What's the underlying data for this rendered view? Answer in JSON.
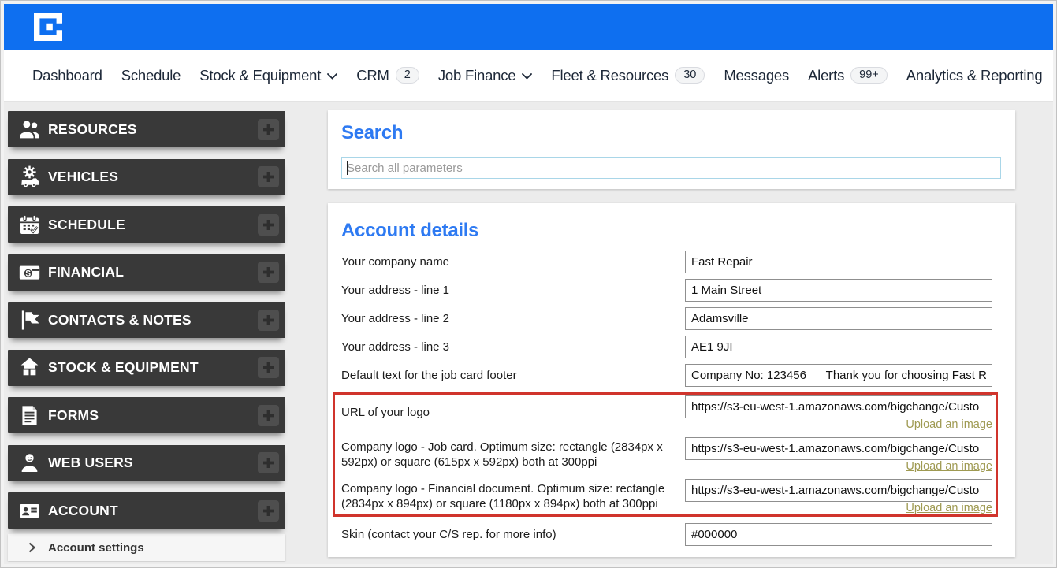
{
  "nav": {
    "items": [
      {
        "label": "Dashboard"
      },
      {
        "label": "Schedule"
      },
      {
        "label": "Stock & Equipment",
        "has_dropdown": true
      },
      {
        "label": "CRM",
        "badge": "2"
      },
      {
        "label": "Job Finance",
        "has_dropdown": true
      },
      {
        "label": "Fleet & Resources",
        "badge": "30"
      },
      {
        "label": "Messages"
      },
      {
        "label": "Alerts",
        "badge": "99+"
      },
      {
        "label": "Analytics & Reporting"
      }
    ]
  },
  "sidebar": {
    "items": [
      {
        "label": "RESOURCES",
        "icon": "people-icon"
      },
      {
        "label": "VEHICLES",
        "icon": "gear-truck-icon"
      },
      {
        "label": "SCHEDULE",
        "icon": "calendar-icon"
      },
      {
        "label": "FINANCIAL",
        "icon": "wallet-icon"
      },
      {
        "label": "CONTACTS & NOTES",
        "icon": "flag-icon"
      },
      {
        "label": "STOCK & EQUIPMENT",
        "icon": "warehouse-icon"
      },
      {
        "label": "FORMS",
        "icon": "document-icon"
      },
      {
        "label": "WEB USERS",
        "icon": "user-icon"
      },
      {
        "label": "ACCOUNT",
        "icon": "id-card-icon"
      }
    ],
    "settings_label": "Account settings"
  },
  "search": {
    "title": "Search",
    "placeholder": "Search all parameters"
  },
  "account": {
    "title": "Account details",
    "fields": [
      {
        "label": "Your company name",
        "value": "Fast Repair"
      },
      {
        "label": "Your address - line 1",
        "value": "1 Main Street"
      },
      {
        "label": "Your address - line 2",
        "value": "Adamsville"
      },
      {
        "label": "Your address - line 3",
        "value": "AE1 9JI"
      },
      {
        "label": "Default text for the job card footer",
        "value": "Company No: 123456      Thank you for choosing Fast R"
      }
    ],
    "logo_fields": [
      {
        "label": "URL of your logo",
        "value": "https://s3-eu-west-1.amazonaws.com/bigchange/Custo",
        "link": "Upload an image"
      },
      {
        "label": "Company logo - Job card. Optimum size: rectangle (2834px x 592px) or square (615px x 592px) both at 300ppi",
        "value": "https://s3-eu-west-1.amazonaws.com/bigchange/Custo",
        "link": "Upload an image"
      },
      {
        "label": "Company logo - Financial document. Optimum size: rectangle (2834px x 894px) or square (1180px x 894px) both at 300ppi",
        "value": "https://s3-eu-west-1.amazonaws.com/bigchange/Custo",
        "link": "Upload an image"
      }
    ],
    "skin_field": {
      "label": "Skin (contact your C/S rep. for more info)",
      "value": "#000000"
    }
  },
  "colors": {
    "header_blue": "#0e6ff0",
    "heading_blue": "#2e7af2",
    "highlight_red": "#d0342c",
    "upload_link_olive": "#9f9a52",
    "sidebar_dark": "#393939"
  }
}
